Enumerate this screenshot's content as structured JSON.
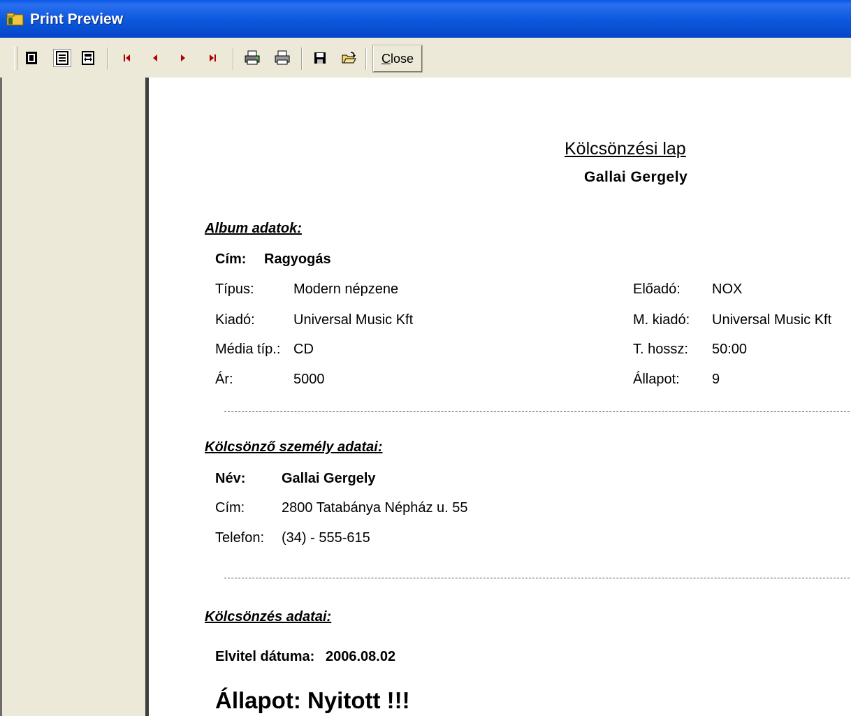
{
  "window": {
    "title": "Print Preview"
  },
  "toolbar": {
    "close_prefix": "C",
    "close_rest": "lose",
    "icons": [
      "one-page-icon",
      "page-width-icon",
      "zoom-fit-icon",
      "first-page-icon",
      "previous-page-icon",
      "next-page-icon",
      "last-page-icon",
      "print-setup-icon",
      "print-icon",
      "save-icon",
      "open-icon"
    ]
  },
  "report": {
    "title": "Kölcsönzési lap",
    "subtitle": "Gallai Gergely",
    "album": {
      "heading": "Album adatok:",
      "title_label": "Cím:",
      "title_value": "Ragyogás",
      "type_label": "Típus:",
      "type_value": "Modern népzene",
      "publisher_label": "Kiadó:",
      "publisher_value": "Universal Music Kft",
      "media_label": "Média típ.:",
      "media_value": "CD",
      "price_label": "Ár:",
      "price_value": "5000",
      "artist_label": "Előadó:",
      "artist_value": "NOX",
      "mpublisher_label": "M. kiadó:",
      "mpublisher_value": "Universal Music Kft",
      "length_label": "T. hossz:",
      "length_value": "50:00",
      "condition_label": "Állapot:",
      "condition_value": "9"
    },
    "person": {
      "heading": "Kölcsönző személy adatai:",
      "name_label": "Név:",
      "name_value": "Gallai Gergely",
      "address_label": "Cím:",
      "address_value": "2800 Tatabánya Népház u. 55",
      "phone_label": "Telefon:",
      "phone_value": "(34) - 555-615"
    },
    "rental": {
      "heading": "Kölcsönzés adatai:",
      "date_label": "Elvitel dátuma:",
      "date_value": "2006.08.02",
      "status_label": "Állapot:",
      "status_value": "Nyitott !!!"
    }
  }
}
